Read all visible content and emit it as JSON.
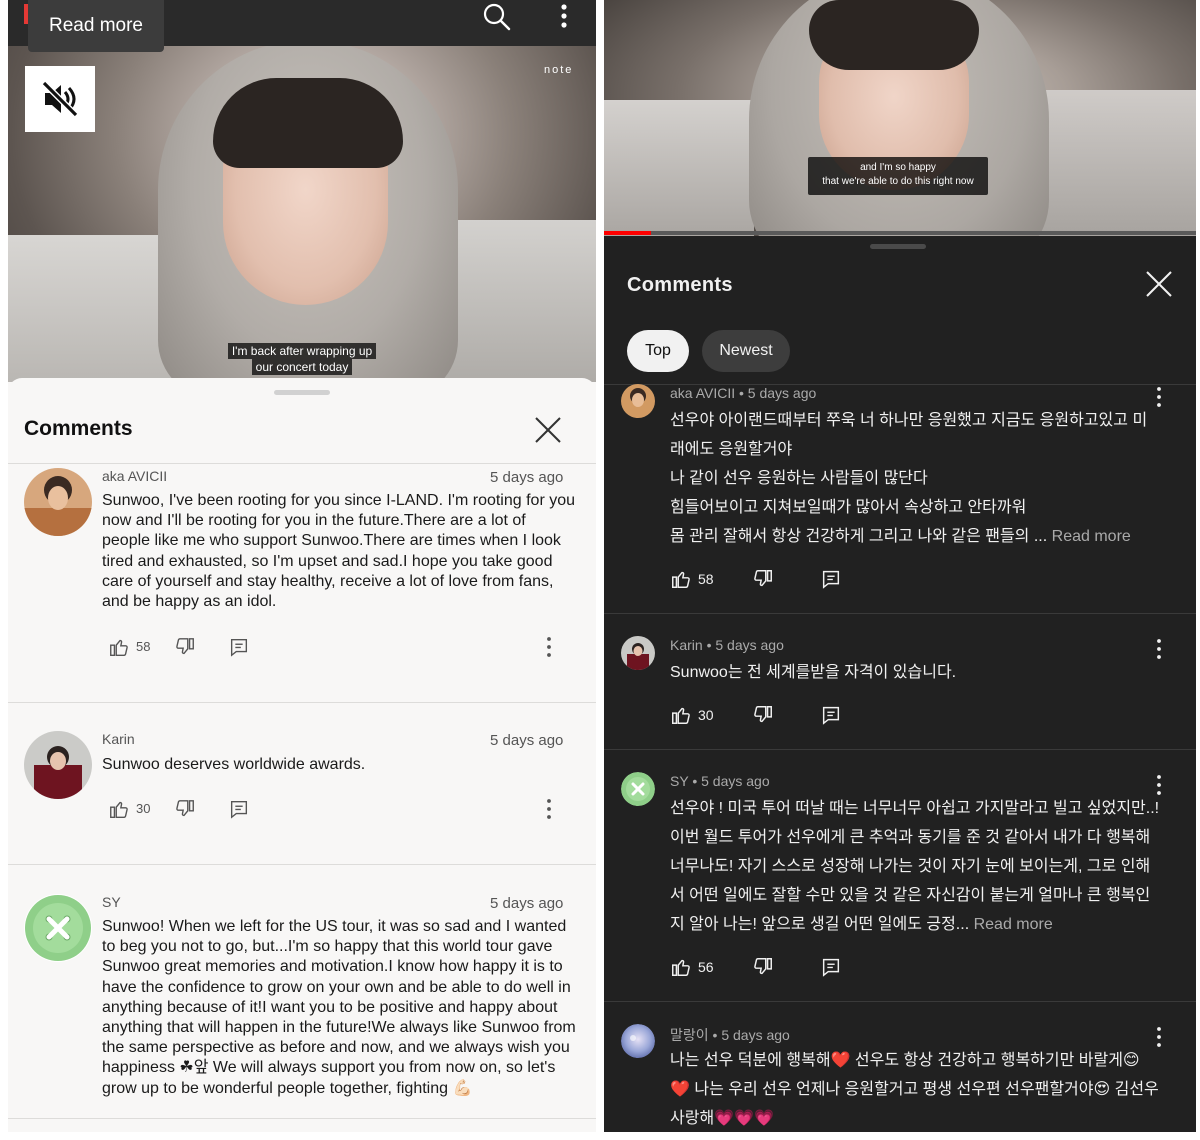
{
  "left": {
    "top_bar": {
      "read_more_label": "Read more"
    },
    "video": {
      "watermark": "note",
      "caption_line1": "I'm back after wrapping up",
      "caption_line2": "our concert today"
    },
    "sheet": {
      "title": "Comments",
      "comments": [
        {
          "author": "aka AVICII",
          "time": "5 days ago",
          "text": "Sunwoo, I've been rooting for you since I-LAND. I'm rooting for you now and I'll be rooting for you in the future.There are a lot of people like me who support Sunwoo.There are times when I look tired and exhausted, so I'm upset and sad.I hope you take good care of yourself and stay healthy, receive a lot of love from fans, and be happy as an idol.",
          "likes": "58"
        },
        {
          "author": "Karin",
          "time": "5 days ago",
          "text": "Sunwoo deserves worldwide awards.",
          "likes": "30"
        },
        {
          "author": "SY",
          "time": "5 days ago",
          "text": "Sunwoo! When we left for the US tour, it was so sad and I wanted to beg you not to go, but...I'm so happy that this world tour gave Sunwoo great memories and motivation.I know how happy it is to have the confidence to grow on your own and be able to do well in anything because of it!I want you to be positive and happy about anything that will happen in the future!We always like Sunwoo from the same perspective as before and now, and we always wish you happiness ☘앞 We will always support you from now on, so let's grow up to be wonderful people together, fighting 💪🏻"
        }
      ]
    }
  },
  "right": {
    "video": {
      "caption_line1": "and I'm so happy",
      "caption_line2": "that we're able to do this right now",
      "progress": 0.08,
      "progress_color": "#ff0000"
    },
    "sheet": {
      "title": "Comments",
      "chips": [
        {
          "label": "Top",
          "selected": true
        },
        {
          "label": "Newest",
          "selected": false
        }
      ],
      "comments": [
        {
          "meta": "aka AVICII • 5 days ago",
          "text": "선우야 아이랜드때부터 쭈욱 너 하나만 응원했고 지금도 응원하고있고 미래에도 응원할거야\n나 같이 선우 응원하는 사람들이 많단다\n힘들어보이고 지쳐보일때가 많아서 속상하고 안타까워\n몸 관리 잘해서 항상 건강하게 그리고 나와 같은 팬들의 ...",
          "read_more": "Read more",
          "likes": "58"
        },
        {
          "meta": "Karin • 5 days ago",
          "text": "Sunwoo는 전 세계를받을 자격이 있습니다.",
          "likes": "30"
        },
        {
          "meta": "SY • 5 days ago",
          "text": "선우야 ! 미국 투어 떠날 때는 너무너무 아쉽고 가지말라고 빌고 싶었지만..! 이번 월드 투어가 선우에게 큰 추억과 동기를 준 것 같아서 내가 다 행복해 너무나도! 자기 스스로 성장해 나가는 것이 자기 눈에 보이는게, 그로 인해서 어떤 일에도 잘할 수만 있을 것 같은 자신감이 붙는게 얼마나 큰 행복인지 알아 나는! 앞으로 생길 어떤 일에도 긍정...",
          "read_more": "Read more",
          "likes": "56"
        },
        {
          "meta": "말랑이 • 5 days ago",
          "text": "나는 선우 덕분에 행복해❤️ 선우도 항상 건강하고 행복하기만 바랄게😊\n❤️ 나는 우리 선우 언제나 응원할거고 평생 선우편 선우팬할거야😍 김선우 사랑해💗💗💗"
        }
      ]
    }
  },
  "icons": {
    "search": "search-icon",
    "more": "more-vert-icon",
    "mute": "volume-off-icon",
    "close": "close-icon",
    "like": "thumb-up-icon",
    "dislike": "thumb-down-icon",
    "reply": "reply-icon"
  }
}
